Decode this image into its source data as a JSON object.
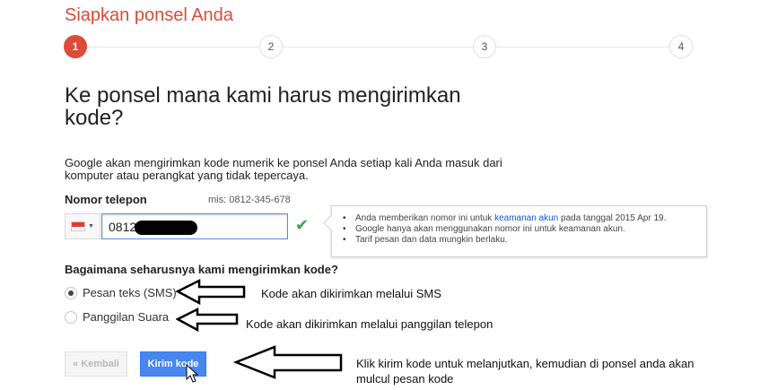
{
  "page": {
    "title": "Siapkan ponsel Anda"
  },
  "steps": [
    {
      "label": "1",
      "active": true
    },
    {
      "label": "2",
      "active": false
    },
    {
      "label": "3",
      "active": false
    },
    {
      "label": "4",
      "active": false
    }
  ],
  "main": {
    "heading": "Ke ponsel mana kami harus mengirimkan kode?",
    "description": "Google akan mengirimkan kode numerik ke ponsel Anda setiap kali Anda masuk dari komputer atau perangkat yang tidak tepercaya."
  },
  "phone": {
    "label": "Nomor telepon",
    "example": "mis: 0812-345-678",
    "value": "0812-",
    "country_flag_icon": "indonesia-flag-icon",
    "valid_icon": "check-icon"
  },
  "tooltip": {
    "item1_prefix": "Anda memberikan nomor ini untuk ",
    "item1_link": "keamanan akun",
    "item1_suffix": " pada tanggal 2015 Apr 19.",
    "item2": "Google hanya akan menggunakan nomor ini untuk keamanan akun.",
    "item3": "Tarif pesan dan data mungkin berlaku."
  },
  "delivery": {
    "question": "Bagaimana seharusnya kami mengirimkan kode?",
    "options": [
      {
        "label": "Pesan teks (SMS)",
        "selected": true
      },
      {
        "label": "Panggilan Suara",
        "selected": false
      }
    ]
  },
  "annotations": {
    "sms": "Kode akan dikirimkan melalui SMS",
    "voice": "Kode akan dikirimkan melalui panggilan telepon",
    "send_line1": "Klik kirim kode untuk melanjutkan, kemudian di ponsel anda akan",
    "send_line2": "mulcul pesan kode"
  },
  "buttons": {
    "back": "« Kembali",
    "send": "Kirim kode"
  },
  "colors": {
    "accent": "#dd4b39",
    "primary_button": "#4787ed",
    "valid": "#3ba353",
    "link": "#1155cc"
  }
}
